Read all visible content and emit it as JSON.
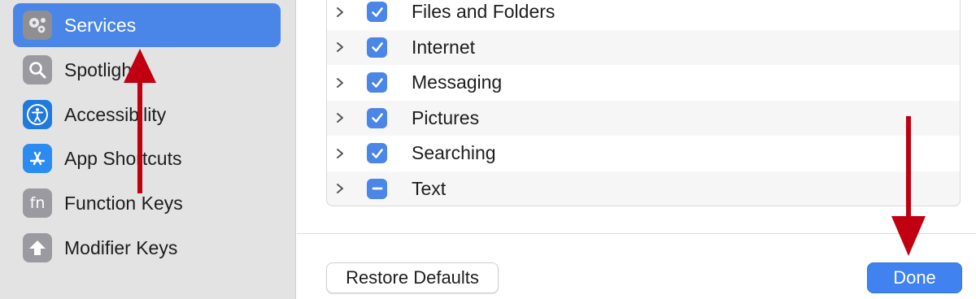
{
  "sidebar": {
    "items": [
      {
        "label": "Services",
        "icon": "gears-icon",
        "selected": true
      },
      {
        "label": "Spotlight",
        "icon": "magnifier-icon",
        "selected": false
      },
      {
        "label": "Accessibility",
        "icon": "accessibility-icon",
        "selected": false
      },
      {
        "label": "App Shortcuts",
        "icon": "app-store-icon",
        "selected": false
      },
      {
        "label": "Function Keys",
        "icon": "fn-icon",
        "selected": false
      },
      {
        "label": "Modifier Keys",
        "icon": "up-arrow-icon",
        "selected": false
      }
    ],
    "fn_glyph": "fn"
  },
  "services_list": [
    {
      "label": "Files and Folders",
      "state": "checked"
    },
    {
      "label": "Internet",
      "state": "checked"
    },
    {
      "label": "Messaging",
      "state": "checked"
    },
    {
      "label": "Pictures",
      "state": "checked"
    },
    {
      "label": "Searching",
      "state": "checked"
    },
    {
      "label": "Text",
      "state": "mixed"
    }
  ],
  "buttons": {
    "restore_defaults": "Restore Defaults",
    "done": "Done"
  },
  "colors": {
    "accent": "#4a86e8",
    "done_button": "#3f82f0",
    "annotation_arrow": "#c00010",
    "sidebar_bg": "#e3e3e3"
  }
}
